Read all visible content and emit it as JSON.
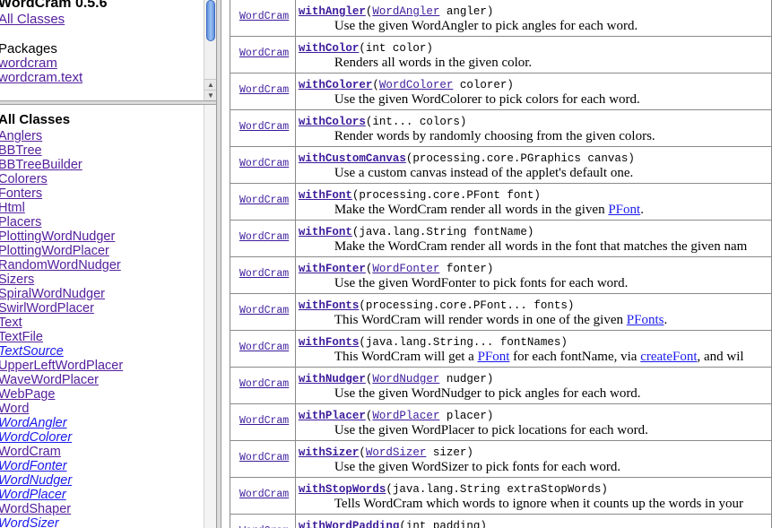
{
  "top_frame": {
    "title": "WordCram 0.5.6",
    "all_classes_link": "All Classes",
    "packages_label": "Packages",
    "packages": [
      "wordcram",
      "wordcram.text"
    ],
    "scroll_up": "▲",
    "scroll_down": "▼"
  },
  "bottom_frame": {
    "heading": "All Classes",
    "classes": [
      {
        "name": "Anglers",
        "interface": false
      },
      {
        "name": "BBTree",
        "interface": false
      },
      {
        "name": "BBTreeBuilder",
        "interface": false
      },
      {
        "name": "Colorers",
        "interface": false
      },
      {
        "name": "Fonters",
        "interface": false
      },
      {
        "name": "Html",
        "interface": false
      },
      {
        "name": "Placers",
        "interface": false
      },
      {
        "name": "PlottingWordNudger",
        "interface": false
      },
      {
        "name": "PlottingWordPlacer",
        "interface": false
      },
      {
        "name": "RandomWordNudger",
        "interface": false
      },
      {
        "name": "Sizers",
        "interface": false
      },
      {
        "name": "SpiralWordNudger",
        "interface": false
      },
      {
        "name": "SwirlWordPlacer",
        "interface": false
      },
      {
        "name": "Text",
        "interface": false
      },
      {
        "name": "TextFile",
        "interface": false
      },
      {
        "name": "TextSource",
        "interface": true
      },
      {
        "name": "UpperLeftWordPlacer",
        "interface": false
      },
      {
        "name": "WaveWordPlacer",
        "interface": false
      },
      {
        "name": "WebPage",
        "interface": false
      },
      {
        "name": "Word",
        "interface": false
      },
      {
        "name": "WordAngler",
        "interface": true
      },
      {
        "name": "WordColorer",
        "interface": true
      },
      {
        "name": "WordCram",
        "interface": false
      },
      {
        "name": "WordFonter",
        "interface": true
      },
      {
        "name": "WordNudger",
        "interface": true
      },
      {
        "name": "WordPlacer",
        "interface": true
      },
      {
        "name": "WordShaper",
        "interface": false
      },
      {
        "name": "WordSizer",
        "interface": true
      }
    ]
  },
  "methods": [
    {
      "return_type": "WordCram",
      "name": "withAngler",
      "sig": [
        {
          "t": "(",
          "l": false
        },
        {
          "t": "WordAngler",
          "l": true
        },
        {
          "t": " angler)",
          "l": false
        }
      ],
      "desc": [
        {
          "t": "Use the given WordAngler to pick angles for each word.",
          "l": false
        }
      ]
    },
    {
      "return_type": "WordCram",
      "name": "withColor",
      "sig": [
        {
          "t": "(int color)",
          "l": false
        }
      ],
      "desc": [
        {
          "t": "Renders all words in the given color.",
          "l": false
        }
      ]
    },
    {
      "return_type": "WordCram",
      "name": "withColorer",
      "sig": [
        {
          "t": "(",
          "l": false
        },
        {
          "t": "WordColorer",
          "l": true
        },
        {
          "t": " colorer)",
          "l": false
        }
      ],
      "desc": [
        {
          "t": "Use the given WordColorer to pick colors for each word.",
          "l": false
        }
      ]
    },
    {
      "return_type": "WordCram",
      "name": "withColors",
      "sig": [
        {
          "t": "(int... colors)",
          "l": false
        }
      ],
      "desc": [
        {
          "t": "Render words by randomly choosing from the given colors.",
          "l": false
        }
      ]
    },
    {
      "return_type": "WordCram",
      "name": "withCustomCanvas",
      "sig": [
        {
          "t": "(processing.core.PGraphics canvas)",
          "l": false
        }
      ],
      "desc": [
        {
          "t": "Use a custom canvas instead of the applet's default one.",
          "l": false
        }
      ]
    },
    {
      "return_type": "WordCram",
      "name": "withFont",
      "sig": [
        {
          "t": "(processing.core.PFont font)",
          "l": false
        }
      ],
      "desc": [
        {
          "t": "Make the WordCram render all words in the given ",
          "l": false
        },
        {
          "t": "PFont",
          "l": true
        },
        {
          "t": ".",
          "l": false
        }
      ]
    },
    {
      "return_type": "WordCram",
      "name": "withFont",
      "sig": [
        {
          "t": "(java.lang.String fontName)",
          "l": false
        }
      ],
      "desc": [
        {
          "t": "Make the WordCram render all words in the font that matches the given nam",
          "l": false
        }
      ]
    },
    {
      "return_type": "WordCram",
      "name": "withFonter",
      "sig": [
        {
          "t": "(",
          "l": false
        },
        {
          "t": "WordFonter",
          "l": true
        },
        {
          "t": " fonter)",
          "l": false
        }
      ],
      "desc": [
        {
          "t": "Use the given WordFonter to pick fonts for each word.",
          "l": false
        }
      ]
    },
    {
      "return_type": "WordCram",
      "name": "withFonts",
      "sig": [
        {
          "t": "(processing.core.PFont... fonts)",
          "l": false
        }
      ],
      "desc": [
        {
          "t": "This WordCram will render words in one of the given ",
          "l": false
        },
        {
          "t": "PFonts",
          "l": true
        },
        {
          "t": ".",
          "l": false
        }
      ]
    },
    {
      "return_type": "WordCram",
      "name": "withFonts",
      "sig": [
        {
          "t": "(java.lang.String... fontNames)",
          "l": false
        }
      ],
      "desc": [
        {
          "t": "This WordCram will get a ",
          "l": false
        },
        {
          "t": "PFont",
          "l": true
        },
        {
          "t": " for each fontName, via ",
          "l": false
        },
        {
          "t": "createFont",
          "l": true
        },
        {
          "t": ", and wil",
          "l": false
        }
      ]
    },
    {
      "return_type": "WordCram",
      "name": "withNudger",
      "sig": [
        {
          "t": "(",
          "l": false
        },
        {
          "t": "WordNudger",
          "l": true
        },
        {
          "t": " nudger)",
          "l": false
        }
      ],
      "desc": [
        {
          "t": "Use the given WordNudger to pick angles for each word.",
          "l": false
        }
      ]
    },
    {
      "return_type": "WordCram",
      "name": "withPlacer",
      "sig": [
        {
          "t": "(",
          "l": false
        },
        {
          "t": "WordPlacer",
          "l": true
        },
        {
          "t": " placer)",
          "l": false
        }
      ],
      "desc": [
        {
          "t": "Use the given WordPlacer to pick locations for each word.",
          "l": false
        }
      ]
    },
    {
      "return_type": "WordCram",
      "name": "withSizer",
      "sig": [
        {
          "t": "(",
          "l": false
        },
        {
          "t": "WordSizer",
          "l": true
        },
        {
          "t": " sizer)",
          "l": false
        }
      ],
      "desc": [
        {
          "t": "Use the given WordSizer to pick fonts for each word.",
          "l": false
        }
      ]
    },
    {
      "return_type": "WordCram",
      "name": "withStopWords",
      "sig": [
        {
          "t": "(java.lang.String extraStopWords)",
          "l": false
        }
      ],
      "desc": [
        {
          "t": "Tells WordCram which words to ignore when it counts up the words in your",
          "l": false
        }
      ]
    },
    {
      "return_type": "WordCram",
      "name": "withWordPadding",
      "sig": [
        {
          "t": "(int padding)",
          "l": false
        }
      ],
      "desc": []
    }
  ]
}
